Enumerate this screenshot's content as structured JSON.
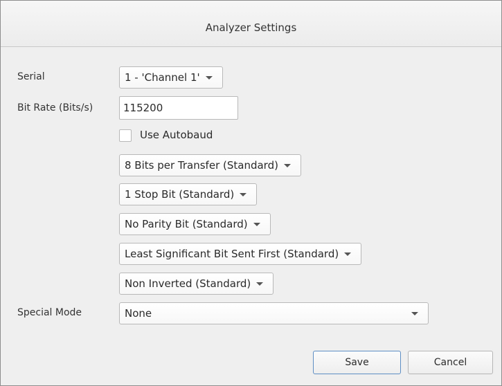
{
  "window": {
    "title": "Analyzer Settings"
  },
  "form": {
    "serial_label": "Serial",
    "serial_value": "1 - 'Channel 1'",
    "bitrate_label": "Bit Rate (Bits/s)",
    "bitrate_value": "115200",
    "autobaud_label": "Use Autobaud",
    "autobaud_checked": false,
    "bits_per_transfer": "8 Bits per Transfer (Standard)",
    "stop_bits": "1 Stop Bit (Standard)",
    "parity": "No Parity Bit (Standard)",
    "bit_order": "Least Significant Bit Sent First (Standard)",
    "inversion": "Non Inverted (Standard)",
    "special_mode_label": "Special Mode",
    "special_mode_value": "None"
  },
  "buttons": {
    "save": "Save",
    "cancel": "Cancel"
  },
  "colors": {
    "default_button_border": "#5d8ec4",
    "dialog_background": "#efefef"
  },
  "icons": {
    "dropdown_arrow": "chevron-down-icon"
  }
}
